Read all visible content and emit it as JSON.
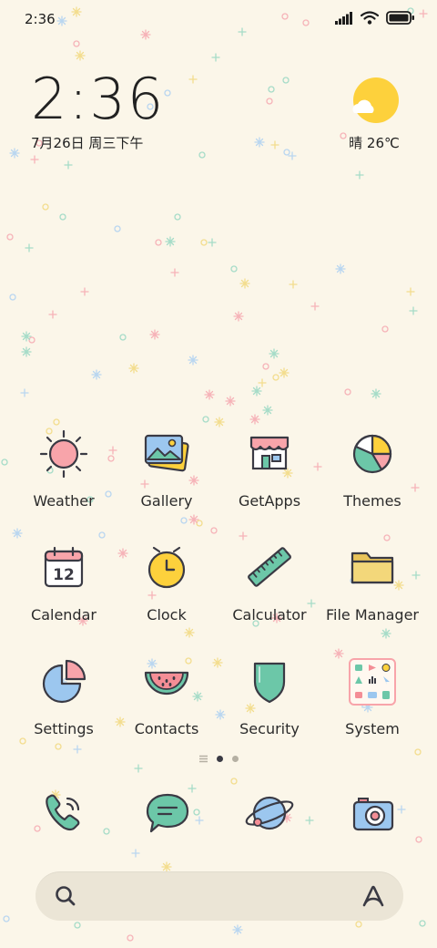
{
  "status_bar": {
    "time": "2:36",
    "icons": [
      "signal-icon",
      "wifi-icon",
      "battery-icon"
    ]
  },
  "clock_widget": {
    "time": "2:36",
    "date": "7月26日 周三下午"
  },
  "weather_widget": {
    "icon": "sun-cloud-icon",
    "condition_temp": "晴 26℃"
  },
  "apps": [
    {
      "label": "Weather",
      "icon": "sun-icon"
    },
    {
      "label": "Gallery",
      "icon": "photos-icon"
    },
    {
      "label": "GetApps",
      "icon": "store-icon"
    },
    {
      "label": "Themes",
      "icon": "palette-icon"
    },
    {
      "label": "Calendar",
      "icon": "calendar-icon",
      "icon_text": "12"
    },
    {
      "label": "Clock",
      "icon": "clock-icon"
    },
    {
      "label": "Calculator",
      "icon": "ruler-icon"
    },
    {
      "label": "File Manager",
      "icon": "folder-icon"
    },
    {
      "label": "Settings",
      "icon": "pie-settings-icon"
    },
    {
      "label": "Contacts",
      "icon": "watermelon-icon"
    },
    {
      "label": "Security",
      "icon": "shield-icon"
    },
    {
      "label": "System",
      "icon": "app-folder-icon"
    }
  ],
  "page_indicator": {
    "pages": 3,
    "current": 1
  },
  "dock": [
    {
      "name": "phone",
      "icon": "phone-icon"
    },
    {
      "name": "messages",
      "icon": "message-icon"
    },
    {
      "name": "browser",
      "icon": "planet-icon"
    },
    {
      "name": "camera",
      "icon": "camera-icon"
    }
  ],
  "search": {
    "left_icon": "search-icon",
    "right_icon": "assistant-icon"
  },
  "colors": {
    "background": "#fbf6e9",
    "sun_yellow": "#fdd13c",
    "pink": "#f69aa0",
    "mint": "#6cc7a8",
    "blue": "#9cc7ef",
    "outline": "#3a3a44"
  }
}
